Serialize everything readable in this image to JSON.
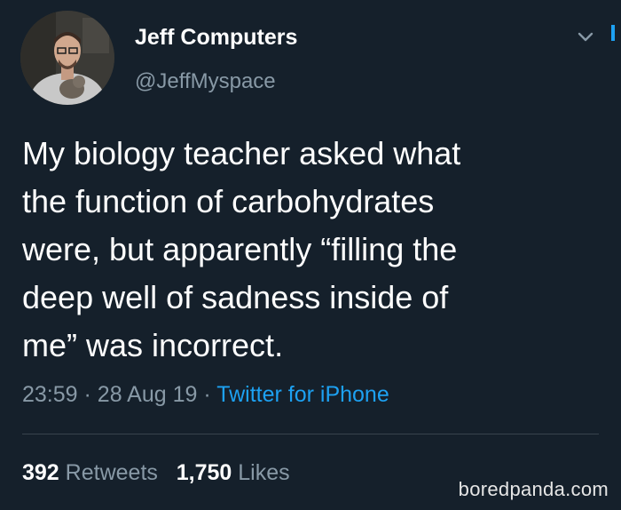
{
  "user": {
    "display_name": "Jeff Computers",
    "handle": "@JeffMyspace"
  },
  "tweet": {
    "text_lines": [
      "My biology teacher asked what",
      "the function of carbohydrates",
      "were, but apparently “filling the",
      "deep well of sadness inside of",
      "me” was incorrect."
    ],
    "time": "23:59",
    "date": "28 Aug 19",
    "separator": "·",
    "source": "Twitter for iPhone"
  },
  "stats": {
    "retweets_count": "392",
    "retweets_label": "Retweets",
    "likes_count": "1,750",
    "likes_label": "Likes"
  },
  "watermark": "boredpanda.com",
  "colors": {
    "background": "#15202b",
    "secondary_text": "#8899a6",
    "link": "#1da1f2",
    "divider": "#38444d"
  },
  "icons": {
    "chevron": "chevron-down-icon"
  }
}
